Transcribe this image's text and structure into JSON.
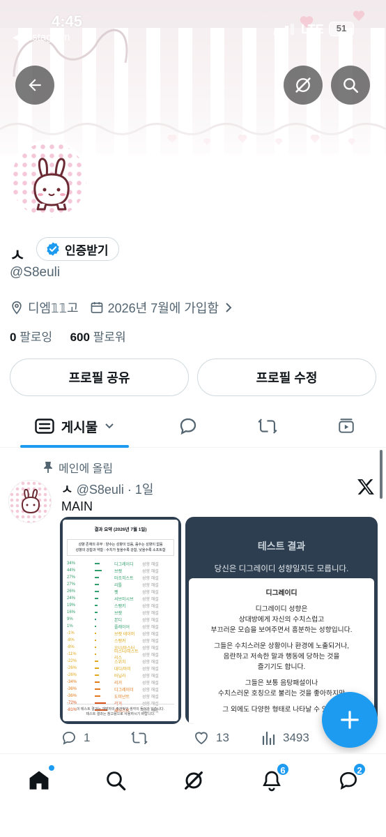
{
  "status_bar": {
    "time": "4:45",
    "back_app": "◀ Instagram",
    "network": "LTE",
    "battery": "51"
  },
  "header": {
    "back_icon": "arrow-left-icon",
    "grok_icon": "grok-icon",
    "search_icon": "search-icon"
  },
  "profile": {
    "name": "ㅅ",
    "verify_label": "인증받기",
    "handle": "@S8euli",
    "location": "디엠𝟙𝟙고",
    "joined": "2026년 7월에 가입함",
    "following_count": "0",
    "following_label": "팔로잉",
    "followers_count": "600",
    "followers_label": "팔로워",
    "share_button": "프로필 공유",
    "edit_button": "프로필 수정"
  },
  "tabs": [
    {
      "label": "게시물",
      "icon": "posts-icon",
      "active": true
    },
    {
      "label": "",
      "icon": "replies-icon"
    },
    {
      "label": "",
      "icon": "repost-icon"
    },
    {
      "label": "",
      "icon": "video-icon"
    }
  ],
  "post": {
    "pinned_label": "메인에 올림",
    "author": "ㅅ",
    "handle": "@S8euli",
    "time": "1일",
    "text": "MAIN",
    "media1": {
      "title": "결과 요약 (2026년 7월 1일)",
      "legend1": "성향 존재의 유무 : 양수는 성향이 있음, 음수는 성향이 없음",
      "legend2": "성향의 강함과 약함 : 수치가 높을수록 강함, 낮을수록 소프트함",
      "rows": [
        {
          "pct": "34%",
          "name": "디그레이디",
          "tag": "성향 해설",
          "color": "#2e9e6b"
        },
        {
          "pct": "44%",
          "name": "브랫",
          "tag": "성향 해설",
          "color": "#2e9e6b"
        },
        {
          "pct": "27%",
          "name": "마조히스트",
          "tag": "성향 해설",
          "color": "#2e9e6b"
        },
        {
          "pct": "27%",
          "name": "리틀",
          "tag": "성향 해설",
          "color": "#2e9e6b"
        },
        {
          "pct": "26%",
          "name": "펫",
          "tag": "성향 해설",
          "color": "#2e9e6b"
        },
        {
          "pct": "24%",
          "name": "서브미시브",
          "tag": "성향 해설",
          "color": "#2e9e6b"
        },
        {
          "pct": "19%",
          "name": "스팽키",
          "tag": "성향 해설",
          "color": "#2e9e6b"
        },
        {
          "pct": "16%",
          "name": "브랫",
          "tag": "성향 해설",
          "color": "#2e9e6b"
        },
        {
          "pct": "9%",
          "name": "본디",
          "tag": "성향 해설",
          "color": "#2e9e6b"
        },
        {
          "pct": "1%",
          "name": "플레이어",
          "tag": "성향 해설",
          "color": "#2e9e6b"
        },
        {
          "pct": "-1%",
          "name": "브랫 테이머",
          "tag": "성향 해설",
          "color": "#e0a81a"
        },
        {
          "pct": "-8%",
          "name": "스팽커",
          "tag": "성향 해설",
          "color": "#e0a81a"
        },
        {
          "pct": "-8%",
          "name": "오너/마스터",
          "tag": "성향 해설",
          "color": "#e0a81a"
        },
        {
          "pct": "-11%",
          "name": "마스터/미스트리스",
          "tag": "성향 해설",
          "color": "#e0a81a"
        },
        {
          "pct": "-22%",
          "name": "스위치",
          "tag": "성향 해설",
          "color": "#e0a81a"
        },
        {
          "pct": "-26%",
          "name": "대디/마미",
          "tag": "성향 해설",
          "color": "#e0a81a"
        },
        {
          "pct": "-26%",
          "name": "바닐라",
          "tag": "성향 해설",
          "color": "#e0a81a"
        },
        {
          "pct": "-34%",
          "name": "리거",
          "tag": "성향 해설",
          "color": "#e07a1a"
        },
        {
          "pct": "-36%",
          "name": "디그레이더",
          "tag": "성향 해설",
          "color": "#e07a1a"
        },
        {
          "pct": "-36%",
          "name": "도미넌트",
          "tag": "성향 해설",
          "color": "#e07a1a"
        },
        {
          "pct": "-72%",
          "name": "리거",
          "tag": "성향 해설",
          "color": "#d9541a"
        },
        {
          "pct": "-81%",
          "name": "새디스트",
          "tag": "성향 해설",
          "color": "#d9541a"
        }
      ],
      "footer1": "이 테스트 결과는 개발자의 주관적인 생각이 들어가 있습니다.",
      "footer2": "테스트 결과는 참고용으로 사용하시기 바랍니다."
    },
    "media2": {
      "title": "테스트 결과",
      "subtitle": "당신은 디그레이디 성향일지도 모릅니다.",
      "card_title": "디그레이디",
      "p1a": "디그레이디 성향은",
      "p1b": "상대방에게 자신의 수치스럽고",
      "p1c": "부끄러운 모습을 보여주면서 흥분하는 성향입니다.",
      "p2a": "그들은 수치스러운 상황이나 환경에 노출되거나,",
      "p2b": "음란하고 저속한 말과 행동에 당하는 것을",
      "p2c": "즐기기도 합니다.",
      "p3a": "그들은 보통 음탕패설이나",
      "p3b": "수치스러운 호칭으로 불리는 것을 좋아하지만",
      "p4": "그 외에도 다양한 형태로 나타날 수 있습니"
    },
    "replies": "1",
    "reposts": "",
    "likes": "13",
    "views": "3493"
  },
  "bottom_nav": {
    "home_icon": "home-icon",
    "search_icon": "search-icon",
    "grok_icon": "grok-icon",
    "notifications_badge": "6",
    "messages_badge": "2"
  },
  "colors": {
    "accent": "#1d9bf0",
    "text": "#0f1419",
    "muted": "#536471"
  }
}
